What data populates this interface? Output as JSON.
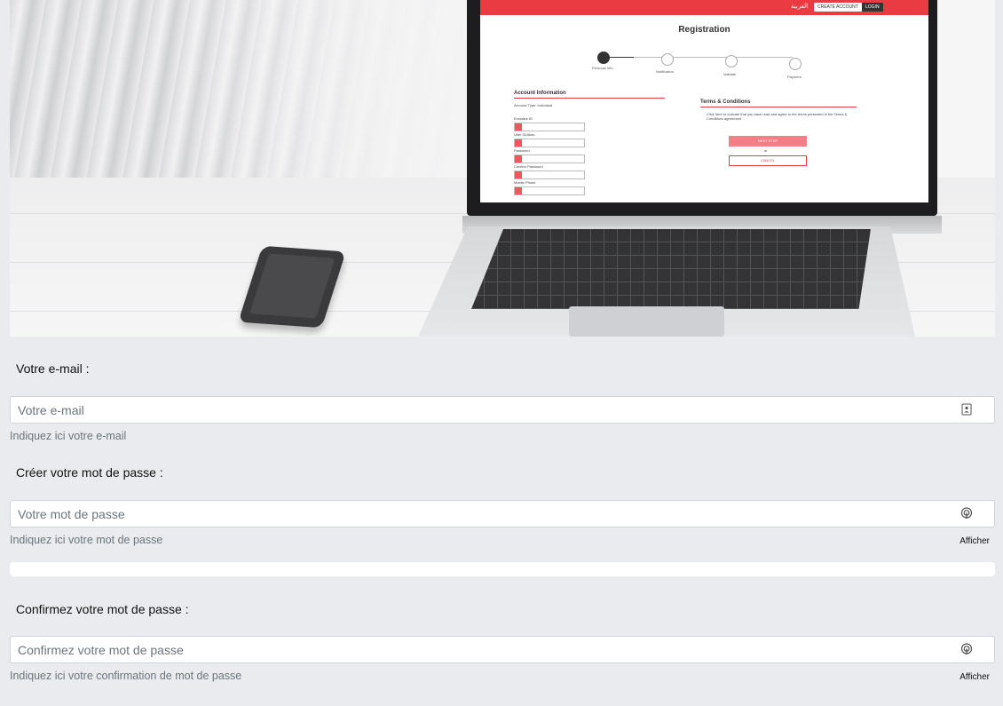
{
  "hero_screen": {
    "lang": "العربية",
    "create_account": "CREATE ACCOUNT",
    "login": "LOGIN",
    "title": "Registration",
    "steps": [
      "Personal Info",
      "Notification",
      "Validate",
      "Payment"
    ],
    "account_section": "Account Information",
    "account_type": "Account Type: Individual",
    "fields": [
      "Emirates ID",
      "User ID/Alias",
      "Password",
      "Confirm Password",
      "Mobile Phone"
    ],
    "terms_section": "Terms & Conditions",
    "terms_text": "Click here to indicate that you have read and agree to the terms presented in the Terms & Conditions agreement",
    "primary_btn": "NEXT STEP",
    "or": "or",
    "secondary_btn": "CANCEL"
  },
  "email": {
    "label": "Votre e-mail :",
    "placeholder": "Votre e-mail",
    "help": "Indiquez ici votre e-mail",
    "icon": "contact-card-icon"
  },
  "password": {
    "label": "Créer votre mot de passe :",
    "placeholder": "Votre mot de passe",
    "help": "Indiquez ici votre mot de passe",
    "toggle": "Afficher",
    "icon": "fingerprint-icon"
  },
  "confirm": {
    "label": "Confirmez votre mot de passe :",
    "placeholder": "Confirmez votre mot de passe",
    "help": "Indiquez ici votre confirmation de mot de passe",
    "toggle": "Afficher",
    "icon": "fingerprint-icon"
  },
  "colors": {
    "page_bg": "#e9ebee",
    "accent": "#ea3b43",
    "help_text": "#6c757d"
  }
}
